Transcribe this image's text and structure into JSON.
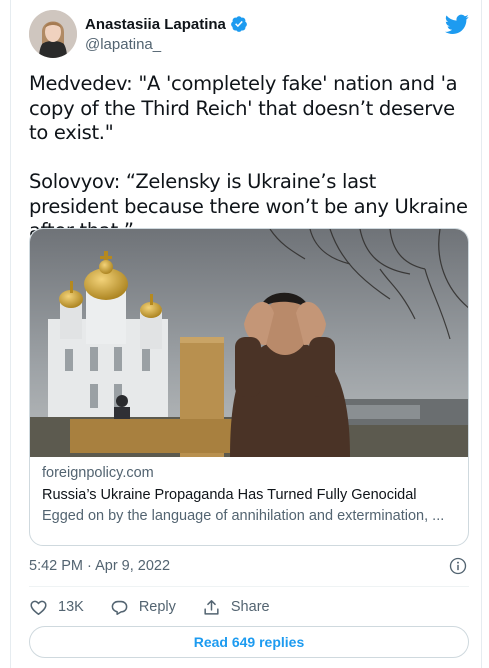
{
  "tweet": {
    "author_name": "Anastasiia Lapatina",
    "author_handle": "@lapatina_",
    "text": "Medvedev: \"A 'completely fake' nation and 'a copy of the Third Reich' that doesn’t deserve to exist.\"\n\nSolovyov: “Zelensky is Ukraine’s last president because there won’t be any Ukraine after that.”",
    "timestamp": "5:42 PM · Apr 9, 2022"
  },
  "link_card": {
    "domain": "foreignpolicy.com",
    "title": "Russia’s Ukraine Propaganda Has Turned Fully Genocidal",
    "description": "Egged on by the language of annihilation and extermination, ..."
  },
  "actions": {
    "likes_count": "13K",
    "reply_label": "Reply",
    "share_label": "Share"
  },
  "replies_button": {
    "label": "Read 649 replies"
  },
  "colors": {
    "accent": "#1d9bf0",
    "text_primary": "#0f1419",
    "text_secondary": "#536471",
    "border": "#cfd9de"
  },
  "icons": {
    "verified": "verified-badge-icon",
    "brand": "twitter-bird-icon",
    "info": "info-icon",
    "like": "heart-icon",
    "reply": "speech-bubble-icon",
    "share": "share-upload-icon"
  }
}
